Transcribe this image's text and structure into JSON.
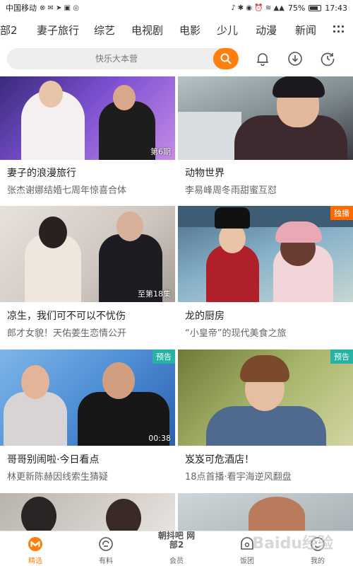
{
  "status_bar": {
    "carrier": "中国移动",
    "battery": "75%",
    "time": "17:43"
  },
  "categories": [
    "部2",
    "妻子旅行",
    "综艺",
    "电视剧",
    "电影",
    "少儿",
    "动漫",
    "新闻"
  ],
  "search": {
    "placeholder": "快乐大本营"
  },
  "cards": [
    {
      "title": "妻子的浪漫旅行",
      "subtitle": "张杰谢娜结婚七周年惊喜合体",
      "overlay": "第6期",
      "badge": ""
    },
    {
      "title": "动物世界",
      "subtitle": "李易峰周冬雨甜蜜互怼",
      "overlay": "",
      "badge": ""
    },
    {
      "title": "凉生，我们可不可以不忧伤",
      "subtitle": "郎才女貌！天佑姜生恋情公开",
      "overlay": "至第18集",
      "badge": ""
    },
    {
      "title": "龙的厨房",
      "subtitle": "“小皇帝”的现代美食之旅",
      "overlay": "",
      "badge": "独播"
    },
    {
      "title": "哥哥别闹啦·今日看点",
      "subtitle": "林更新陈赫因线索生猜疑",
      "overlay": "00:38",
      "badge": "预告"
    },
    {
      "title": "岌岌可危酒店！",
      "subtitle": "18点首播·看宇海逆风翻盘",
      "overlay": "",
      "badge": "预告"
    }
  ],
  "tabs": [
    {
      "label": "精选",
      "icon": "mango-logo-icon",
      "active": true
    },
    {
      "label": "有料",
      "icon": "feed-icon",
      "active": false
    },
    {
      "label": "会员",
      "icon": "vip-icon",
      "active": false
    },
    {
      "label": "饭团",
      "icon": "fan-group-icon",
      "active": false
    },
    {
      "label": "我的",
      "icon": "profile-icon",
      "active": false
    }
  ],
  "tab_banner_text": "朝抖吧 网部2",
  "watermark": "Baidu经验",
  "colors": {
    "accent": "#ff7e0e",
    "badge_orange": "#ff6a00",
    "badge_teal": "#26b3a6"
  }
}
